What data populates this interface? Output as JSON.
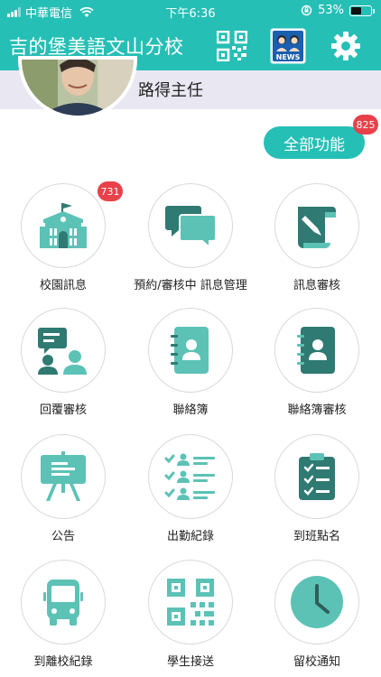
{
  "status_bar": {
    "carrier": "中華電信",
    "time": "下午6:36",
    "battery": "53%",
    "battery_level": 0.53
  },
  "header": {
    "title": "吉的堡美語文山分校",
    "qr_icon": "qr-code-icon",
    "news_icon": "news-icon",
    "news_label": "NEWS",
    "settings_icon": "gear-icon"
  },
  "profile": {
    "name": "路得主任"
  },
  "all_functions": {
    "label": "全部功能",
    "badge": "825"
  },
  "functions": [
    {
      "label": "校園訊息",
      "icon": "school-building-icon",
      "badge": "731"
    },
    {
      "label": "預約/審核中 訊息管理",
      "icon": "chat-bubbles-icon"
    },
    {
      "label": "訊息審核",
      "icon": "message-review-icon"
    },
    {
      "label": "回覆審核",
      "icon": "reply-review-icon"
    },
    {
      "label": "聯絡簿",
      "icon": "contact-book-icon"
    },
    {
      "label": "聯絡簿審核",
      "icon": "contact-book-review-icon"
    },
    {
      "label": "公告",
      "icon": "easel-board-icon"
    },
    {
      "label": "出勤紀錄",
      "icon": "attendance-list-icon"
    },
    {
      "label": "到班點名",
      "icon": "clipboard-checklist-icon"
    },
    {
      "label": "到離校紀錄",
      "icon": "bus-icon"
    },
    {
      "label": "學生接送",
      "icon": "qr-scan-icon"
    },
    {
      "label": "留校通知",
      "icon": "clock-icon"
    }
  ],
  "colors": {
    "brand": "#26bfb5",
    "icon": "#5cc2b6",
    "icon_dark": "#2f7a73",
    "badge": "#e8414a",
    "profile_strip": "#e9e8f2"
  }
}
